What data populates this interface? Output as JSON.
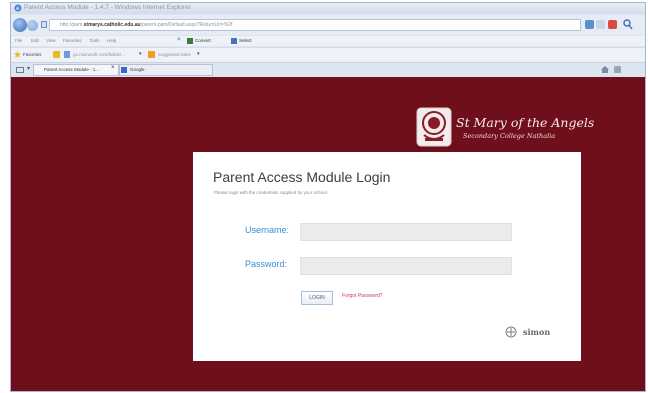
{
  "window": {
    "title": "Parent Access Module - 1.4.7 - Windows Internet Explorer"
  },
  "browser": {
    "address_prefix": "http://pam.",
    "address_domain": "stmarys.catholic.edu.au",
    "address_suffix": "/parent-pam/Default.aspx?ReturnUrl=%2f",
    "menu": [
      "File",
      "Edit",
      "View",
      "Favorites",
      "Tools",
      "Help"
    ],
    "convert_label": "Convert",
    "select_label": "Select",
    "favorites_label": "Favorites",
    "fav_link": "go.microsoft.com/fwlink/...",
    "suggested_label": "Suggested Sites",
    "tabs": [
      {
        "label": "Parent Access Module - 1...",
        "active": true
      },
      {
        "label": "Google",
        "active": false
      }
    ]
  },
  "school": {
    "name": "St Mary of the Angels",
    "subtitle": "Secondary College Nathalia"
  },
  "login": {
    "title": "Parent Access Module Login",
    "subtitle": "Please login with the credentials supplied by your school.",
    "username_label": "Username:",
    "password_label": "Password:",
    "username_value": "",
    "password_value": "",
    "login_button": "LOGIN",
    "forgot_link": "Forgot Password?",
    "brand": "simon"
  },
  "colors": {
    "background": "#6e0f1b",
    "label": "#3a8fd6",
    "forgot": "#d6336c"
  }
}
